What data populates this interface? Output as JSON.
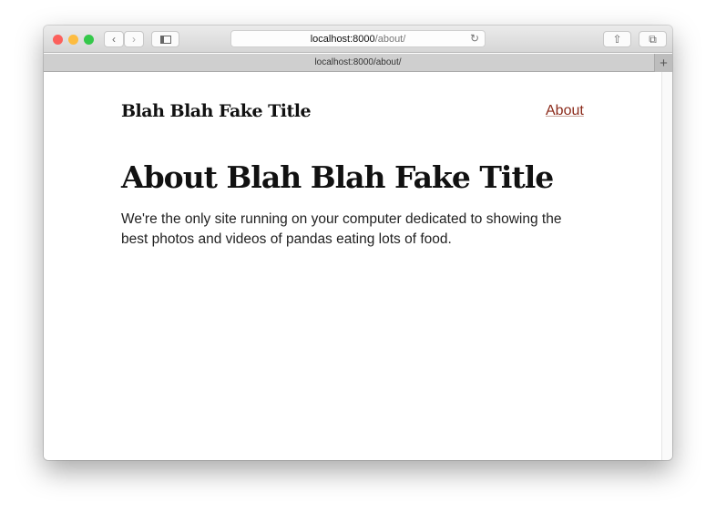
{
  "browser": {
    "address_host": "localhost:8000",
    "address_path": "/about/",
    "tab_title": "localhost:8000/about/",
    "icons": {
      "back": "chevron-left",
      "forward": "chevron-right",
      "sidebar": "sidebar",
      "reload": "reload",
      "share": "share",
      "tabs": "tabs",
      "new_tab": "plus"
    }
  },
  "page": {
    "site_title": "Blah Blah Fake Title",
    "nav": [
      {
        "label": "About"
      }
    ],
    "heading": "About Blah Blah Fake Title",
    "paragraph": "We're the only site running on your computer dedicated to showing the best photos and videos of pandas eating lots of food.",
    "link_color": "#8b2a1a"
  }
}
